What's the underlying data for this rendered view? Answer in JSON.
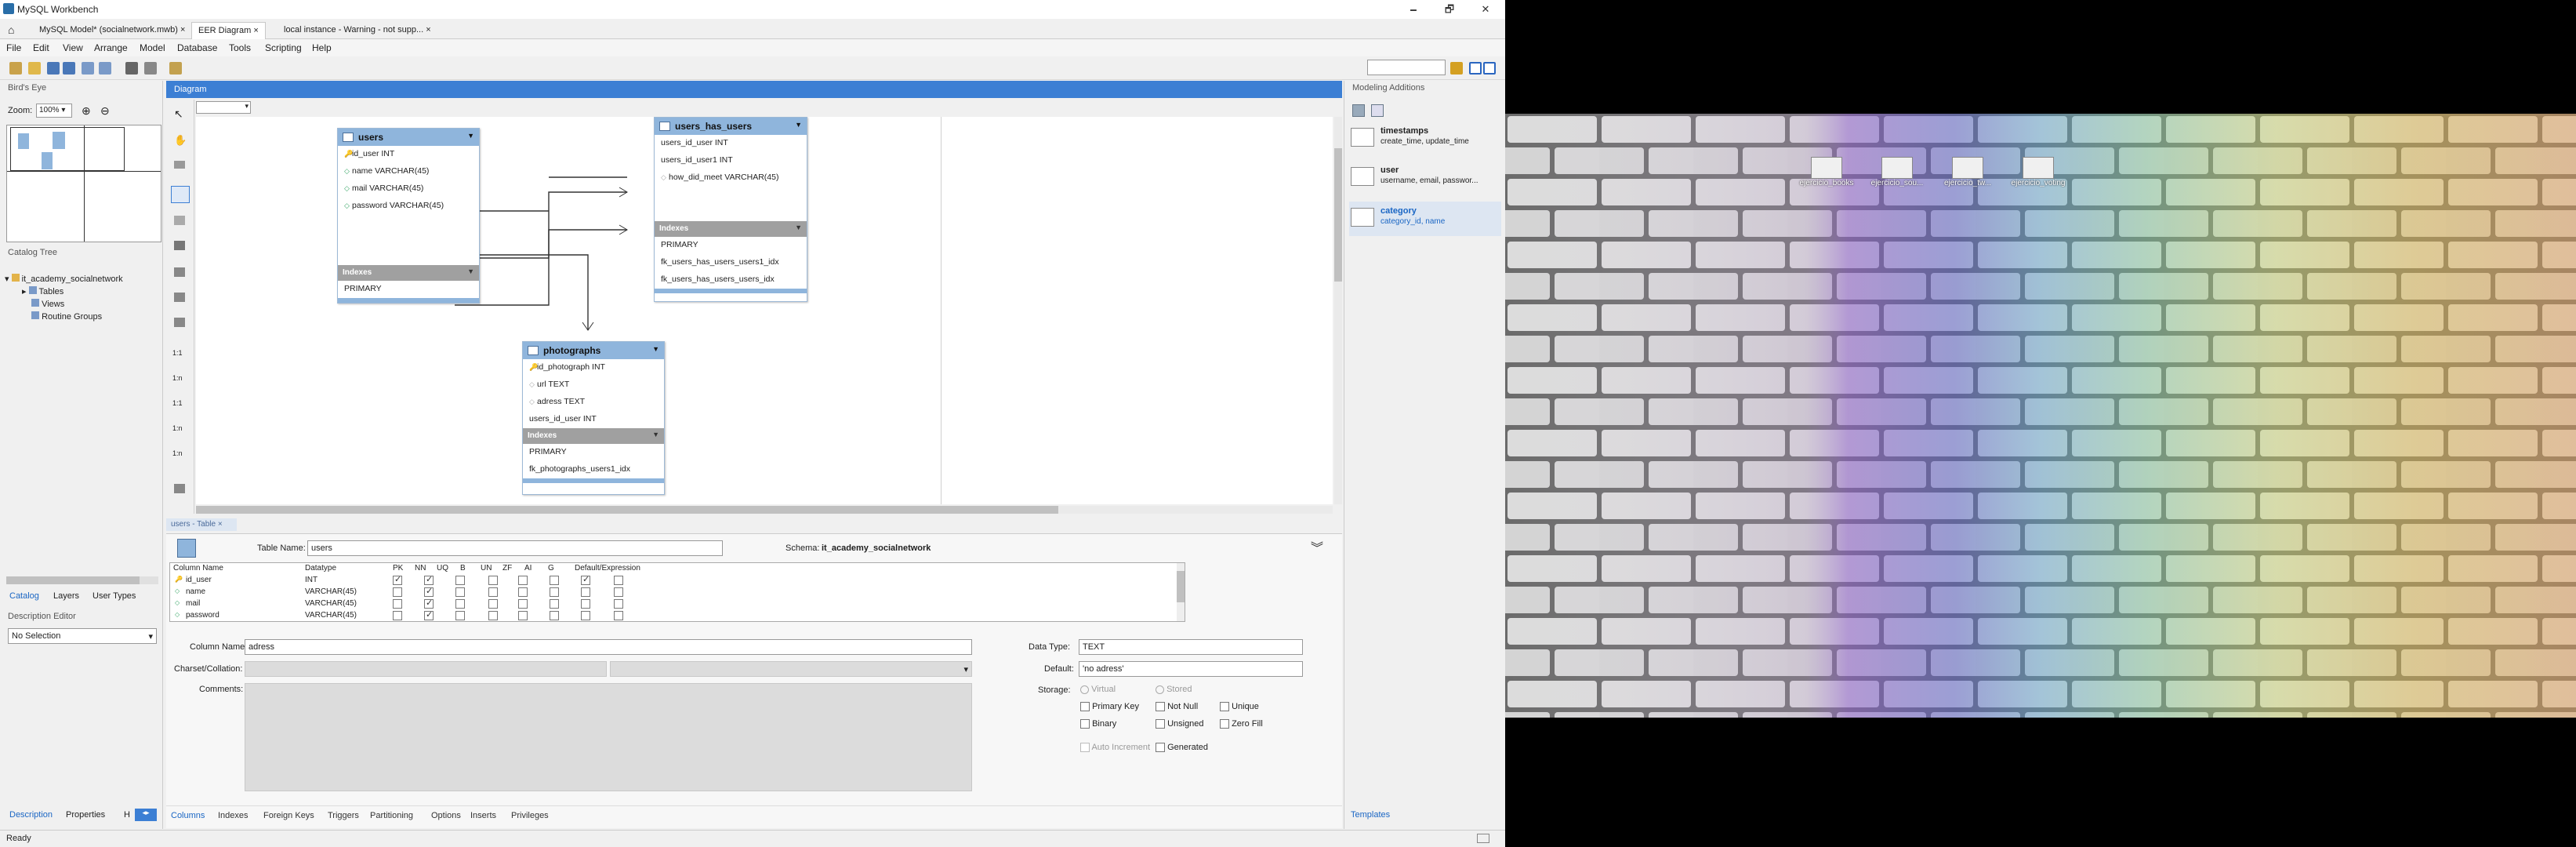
{
  "app_title": "MySQL Workbench",
  "window_controls": {
    "minimize": "🗕",
    "restore": "🗗",
    "close": "✕"
  },
  "tabs": [
    {
      "label": "MySQL Model* (socialnetwork.mwb)",
      "closable": true
    },
    {
      "label": "EER Diagram",
      "closable": true
    },
    {
      "label": "local instance - Warning - not supp...",
      "closable": true
    }
  ],
  "tab_close_glyph": "×",
  "menu": [
    "File",
    "Edit",
    "View",
    "Arrange",
    "Model",
    "Database",
    "Tools",
    "Scripting",
    "Help"
  ],
  "birds_eye": {
    "title": "Bird's Eye",
    "zoom_label": "Zoom:",
    "zoom_value": "100%"
  },
  "catalog_tree": {
    "title": "Catalog Tree",
    "schema": "it_academy_socialnetwork",
    "items": [
      "Tables",
      "Views",
      "Routine Groups"
    ]
  },
  "left_tabs": [
    "Catalog",
    "Layers",
    "User Types"
  ],
  "description_editor": {
    "title": "Description Editor",
    "value": "No Selection"
  },
  "left_bottom_tabs": [
    "Description",
    "Properties",
    "H"
  ],
  "diagram": {
    "title": "Diagram",
    "tables": {
      "users": {
        "name": "users",
        "columns": [
          {
            "label": "id_user INT",
            "type": "pk"
          },
          {
            "label": "name VARCHAR(45)",
            "type": "col"
          },
          {
            "label": "mail VARCHAR(45)",
            "type": "col"
          },
          {
            "label": "password VARCHAR(45)",
            "type": "col"
          }
        ],
        "indexes_label": "Indexes",
        "indexes": [
          "PRIMARY"
        ]
      },
      "users_has_users": {
        "name": "users_has_users",
        "columns": [
          {
            "label": "users_id_user INT",
            "type": "fk"
          },
          {
            "label": "users_id_user1 INT",
            "type": "fk"
          },
          {
            "label": "how_did_meet VARCHAR(45)",
            "type": "col"
          }
        ],
        "indexes_label": "Indexes",
        "indexes": [
          "PRIMARY",
          "fk_users_has_users_users1_idx",
          "fk_users_has_users_users_idx"
        ]
      },
      "photographs": {
        "name": "photographs",
        "columns": [
          {
            "label": "id_photograph INT",
            "type": "pk"
          },
          {
            "label": "url TEXT",
            "type": "col"
          },
          {
            "label": "adress TEXT",
            "type": "col"
          },
          {
            "label": "users_id_user INT",
            "type": "fk"
          }
        ],
        "indexes_label": "Indexes",
        "indexes": [
          "PRIMARY",
          "fk_photographs_users1_idx"
        ]
      }
    },
    "side_labels": [
      "1:1",
      "1:n",
      "1:1",
      "1:n",
      "1:n"
    ]
  },
  "table_editor": {
    "tab_label": "users - Table",
    "table_name_label": "Table Name:",
    "table_name": "users",
    "schema_label": "Schema:",
    "schema": "it_academy_socialnetwork",
    "grid_headers": [
      "Column Name",
      "Datatype",
      "PK",
      "NN",
      "UQ",
      "B",
      "UN",
      "ZF",
      "AI",
      "G",
      "Default/Expression"
    ],
    "rows": [
      {
        "name": "id_user",
        "type": "INT",
        "flags": [
          1,
          1,
          0,
          0,
          0,
          0,
          1,
          0
        ],
        "key": "pk"
      },
      {
        "name": "name",
        "type": "VARCHAR(45)",
        "flags": [
          0,
          1,
          0,
          0,
          0,
          0,
          0,
          0
        ],
        "key": "col"
      },
      {
        "name": "mail",
        "type": "VARCHAR(45)",
        "flags": [
          0,
          1,
          0,
          0,
          0,
          0,
          0,
          0
        ],
        "key": "col"
      },
      {
        "name": "password",
        "type": "VARCHAR(45)",
        "flags": [
          0,
          1,
          0,
          0,
          0,
          0,
          0,
          0
        ],
        "key": "col"
      }
    ],
    "column_name_label": "Column Name:",
    "column_name": "adress",
    "charset_label": "Charset/Collation:",
    "comments_label": "Comments:",
    "data_type_label": "Data Type:",
    "data_type": "TEXT",
    "default_label": "Default:",
    "default_value": "'no adress'",
    "storage_label": "Storage:",
    "storage_opts": [
      "Virtual",
      "Stored"
    ],
    "checks": [
      "Primary Key",
      "Not Null",
      "Unique",
      "Binary",
      "Unsigned",
      "Zero Fill"
    ],
    "auto_increment": "Auto Increment",
    "generated": "Generated",
    "bottom_tabs": [
      "Columns",
      "Indexes",
      "Foreign Keys",
      "Triggers",
      "Partitioning",
      "Options",
      "Inserts",
      "Privileges"
    ]
  },
  "modeling_additions": {
    "title": "Modeling Additions",
    "items": [
      {
        "name": "timestamps",
        "desc": "create_time, update_time"
      },
      {
        "name": "user",
        "desc": "username, email, passwor..."
      },
      {
        "name": "category",
        "desc": "category_id, name"
      }
    ],
    "templates_tab": "Templates"
  },
  "status": "Ready",
  "desktop": {
    "icons": [
      "ejercicio_books",
      "ejercicio_sou...",
      "ejercicio_tw...",
      "ejercicio_voting"
    ]
  },
  "colors": {
    "accent": "#3c7fd4",
    "table_header": "#8fb5dc"
  }
}
